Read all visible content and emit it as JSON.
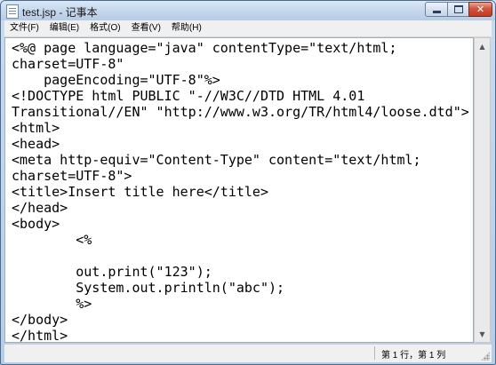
{
  "window": {
    "title": "test.jsp - 记事本"
  },
  "menu": {
    "items": [
      {
        "id": "file",
        "label": "文件(F)"
      },
      {
        "id": "edit",
        "label": "编辑(E)"
      },
      {
        "id": "format",
        "label": "格式(O)"
      },
      {
        "id": "view",
        "label": "查看(V)"
      },
      {
        "id": "help",
        "label": "帮助(H)"
      }
    ]
  },
  "editor": {
    "lines": [
      "<%@ page language=\"java\" contentType=\"text/html;",
      "charset=UTF-8\"",
      "    pageEncoding=\"UTF-8\"%>",
      "<!DOCTYPE html PUBLIC \"-//W3C//DTD HTML 4.01",
      "Transitional//EN\" \"http://www.w3.org/TR/html4/loose.dtd\">",
      "<html>",
      "<head>",
      "<meta http-equiv=\"Content-Type\" content=\"text/html;",
      "charset=UTF-8\">",
      "<title>Insert title here</title>",
      "</head>",
      "<body>",
      "        <%",
      "",
      "        out.print(\"123\");",
      "        System.out.println(\"abc\");",
      "        %>",
      "</body>",
      "</html>"
    ]
  },
  "status": {
    "position": "第 1 行，第 1 列"
  },
  "icons": {
    "app": "notepad-icon",
    "minimize": "minimize-icon",
    "maximize": "maximize-icon",
    "close": "close-icon"
  }
}
